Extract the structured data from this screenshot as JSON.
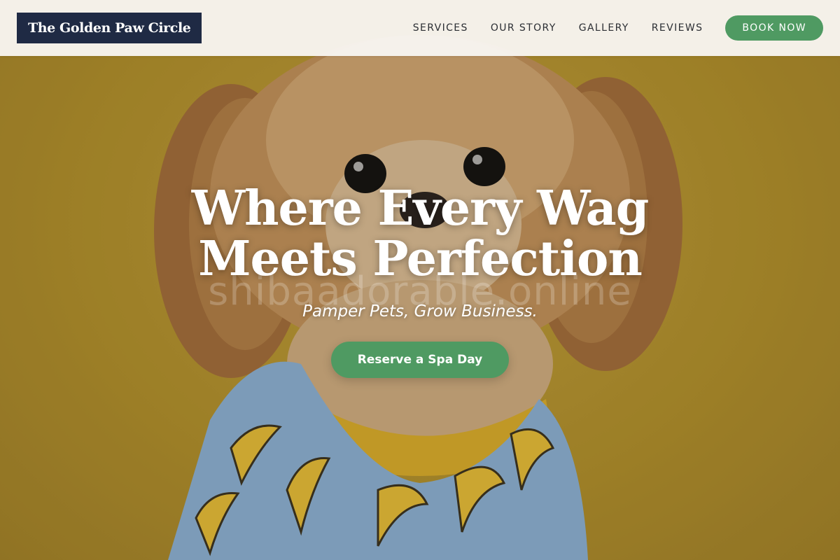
{
  "brand": {
    "logo_text": "The Golden Paw Circle"
  },
  "nav": {
    "links": [
      {
        "label": "SERVICES"
      },
      {
        "label": "OUR STORY"
      },
      {
        "label": "GALLERY"
      },
      {
        "label": "REVIEWS"
      }
    ],
    "book_label": "BOOK NOW"
  },
  "hero": {
    "title": "Where Every Wag Meets Perfection",
    "subtitle": "Pamper Pets, Grow Business.",
    "cta_label": "Reserve a Spa Day",
    "watermark": "shibaadorable.online",
    "image_subject": "dog-photo"
  },
  "colors": {
    "brand_navy": "#1f2a44",
    "accent_green": "#4f9a62",
    "nav_background": "#f8f5f0",
    "hero_mustard": "#b8962e",
    "shirt_blue": "#8fb7de",
    "banana_yellow": "#f0c53a"
  }
}
